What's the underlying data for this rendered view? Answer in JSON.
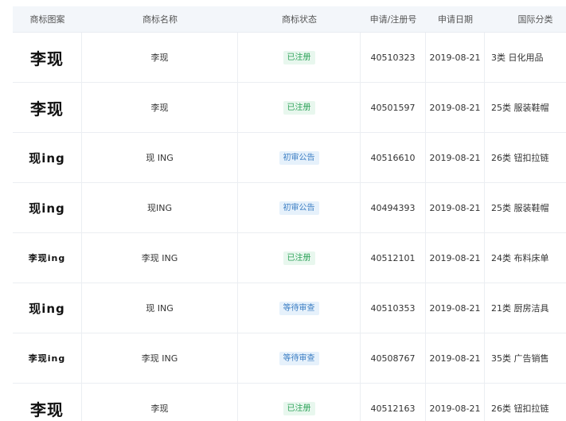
{
  "headers": {
    "logo": "商标图案",
    "name": "商标名称",
    "status": "商标状态",
    "regno": "申请/注册号",
    "date": "申请日期",
    "class": "国际分类"
  },
  "colors": {
    "registered_text": "#2fa35a",
    "registered_bg": "#e8f7ee",
    "pending_text": "#3d7fc4",
    "pending_bg": "#e6f1fb",
    "header_bg": "#f3f6fa"
  },
  "rows": [
    {
      "logo": "李现",
      "logo_size": "lg",
      "name": "李现",
      "status": "已注册",
      "status_type": "registered",
      "regno": "40510323",
      "date": "2019-08-21",
      "class": "3类 日化用品"
    },
    {
      "logo": "李现",
      "logo_size": "lg",
      "name": "李现",
      "status": "已注册",
      "status_type": "registered",
      "regno": "40501597",
      "date": "2019-08-21",
      "class": "25类 服装鞋帽"
    },
    {
      "logo": "现ing",
      "logo_size": "md",
      "name": "现 ING",
      "status": "初审公告",
      "status_type": "prelim",
      "regno": "40516610",
      "date": "2019-08-21",
      "class": "26类 钮扣拉链"
    },
    {
      "logo": "现ing",
      "logo_size": "md",
      "name": "现ING",
      "status": "初审公告",
      "status_type": "prelim",
      "regno": "40494393",
      "date": "2019-08-21",
      "class": "25类 服装鞋帽"
    },
    {
      "logo": "李现ing",
      "logo_size": "sm",
      "name": "李现 ING",
      "status": "已注册",
      "status_type": "registered",
      "regno": "40512101",
      "date": "2019-08-21",
      "class": "24类 布料床单"
    },
    {
      "logo": "现ing",
      "logo_size": "md",
      "name": "现 ING",
      "status": "等待审查",
      "status_type": "waiting",
      "regno": "40510353",
      "date": "2019-08-21",
      "class": "21类 厨房洁具"
    },
    {
      "logo": "李现ing",
      "logo_size": "sm",
      "name": "李现 ING",
      "status": "等待审查",
      "status_type": "waiting",
      "regno": "40508767",
      "date": "2019-08-21",
      "class": "35类 广告销售"
    },
    {
      "logo": "李现",
      "logo_size": "lg",
      "name": "李现",
      "status": "已注册",
      "status_type": "registered",
      "regno": "40512163",
      "date": "2019-08-21",
      "class": "26类 钮扣拉链"
    }
  ]
}
